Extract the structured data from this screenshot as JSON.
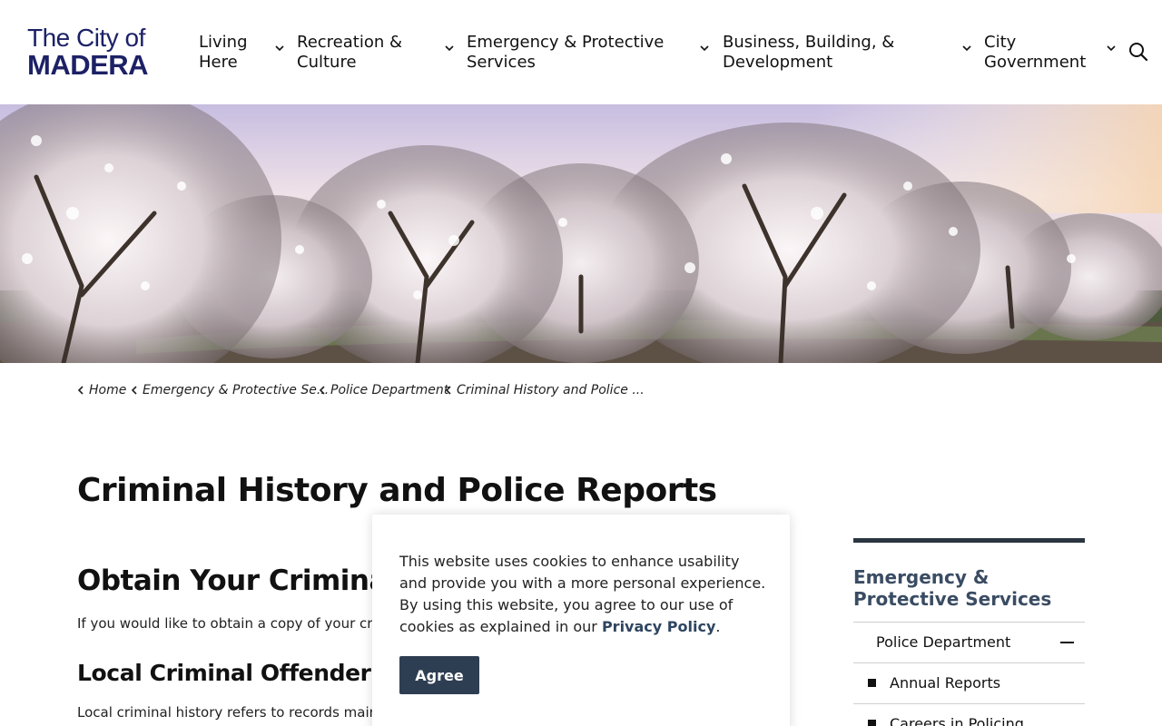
{
  "logo": {
    "line1": "The City of",
    "line2": "MADERA"
  },
  "nav": [
    {
      "line1": "Living",
      "line2": "Here"
    },
    {
      "line1": "Recreation &",
      "line2": "Culture"
    },
    {
      "line1": "Emergency & Protective",
      "line2": "Services"
    },
    {
      "line1": "Business, Building, &",
      "line2": "Development"
    },
    {
      "line1": "City",
      "line2": "Government"
    }
  ],
  "icons": {
    "search": "search-icon",
    "nav_chevron": "chevron-down-icon",
    "breadcrumb_chevron": "chevron-left-icon"
  },
  "breadcrumb": [
    "Home",
    "Emergency & Protective Se...",
    "Police Department",
    "Criminal History and Police ..."
  ],
  "page": {
    "title": "Criminal History and Police Reports",
    "section1_heading": "Obtain Your Criminal",
    "section1_text": "If you would like to obtain a copy of your crim",
    "section2_heading": "Local Criminal Offender Re",
    "section2_text": "Local criminal history refers to records main"
  },
  "sidebar": {
    "title": "Emergency & Protective Services",
    "items": [
      {
        "label": "Police Department"
      },
      {
        "label": "Annual Reports"
      },
      {
        "label": "Careers in Policing"
      }
    ]
  },
  "cookie": {
    "text": "This website uses cookies to enhance usability and provide you with a more personal experience. By using this website, you agree to our use of cookies as explained in our ",
    "link": "Privacy Policy",
    "end": ".",
    "button": "Agree"
  },
  "colors": {
    "logo": "#1c2166",
    "sidebar_title": "#3a4c63",
    "sidebar_rule": "#2b3642",
    "agree_button": "#2e3e52",
    "link": "#2e4560"
  }
}
